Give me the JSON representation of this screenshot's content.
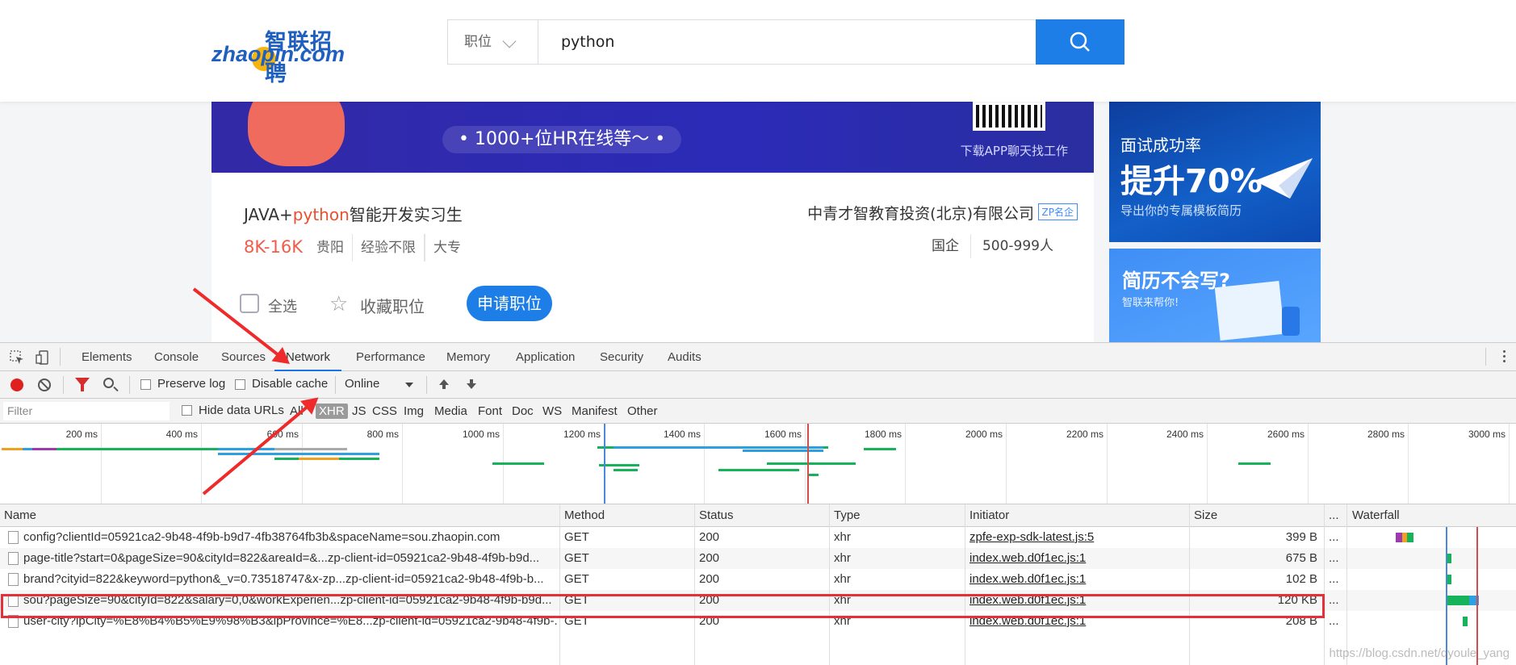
{
  "site": {
    "logo_cn": "智联招聘",
    "logo_en": "zhaopin.com",
    "search_category": "职位",
    "search_query": "python"
  },
  "banner": {
    "hr_text": "• 1000+位HR在线等～ •",
    "download_text": "下载APP聊天找工作"
  },
  "job": {
    "title_prefix": "JAVA+",
    "title_highlight": "python",
    "title_suffix": "智能开发实习生",
    "salary": "8K-16K",
    "tags": [
      "贵阳",
      "经验不限",
      "大专"
    ],
    "company": "中青才智教育投资(北京)有限公司",
    "company_badge": "ZP名企",
    "company_type": "国企",
    "company_size": "500-999人"
  },
  "actions": {
    "select_all": "全选",
    "favorite": "收藏职位",
    "apply": "申请职位"
  },
  "ads": {
    "ad1_line1": "面试成功率",
    "ad1_line2": "提升70%",
    "ad1_line3": "导出你的专属模板简历",
    "ad2_line1": "简历不会写?",
    "ad2_line2": "智联来帮你!"
  },
  "devtools": {
    "tabs": [
      "Elements",
      "Console",
      "Sources",
      "Network",
      "Performance",
      "Memory",
      "Application",
      "Security",
      "Audits"
    ],
    "active_tab": "Network",
    "preserve_log": "Preserve log",
    "disable_cache": "Disable cache",
    "throttle": "Online",
    "filter_placeholder": "Filter",
    "hide_data_urls": "Hide data URLs",
    "types": [
      "All",
      "XHR",
      "JS",
      "CSS",
      "Img",
      "Media",
      "Font",
      "Doc",
      "WS",
      "Manifest",
      "Other"
    ],
    "active_type": "XHR",
    "ticks": [
      "200 ms",
      "400 ms",
      "600 ms",
      "800 ms",
      "1000 ms",
      "1200 ms",
      "1400 ms",
      "1600 ms",
      "1800 ms",
      "2000 ms",
      "2200 ms",
      "2400 ms",
      "2600 ms",
      "2800 ms",
      "3000 ms"
    ],
    "columns": [
      "Name",
      "Method",
      "Status",
      "Type",
      "Initiator",
      "Size",
      "...",
      "Waterfall"
    ],
    "rows": [
      {
        "name": "config?clientId=05921ca2-9b48-4f9b-b9d7-4fb38764fb3b&spaceName=sou.zhaopin.com",
        "method": "GET",
        "status": "200",
        "type": "xhr",
        "initiator": "zpfe-exp-sdk-latest.js:5",
        "size": "399 B",
        "more": "..."
      },
      {
        "name": "page-title?start=0&pageSize=90&cityId=822&areaId=&...zp-client-id=05921ca2-9b48-4f9b-b9d...",
        "method": "GET",
        "status": "200",
        "type": "xhr",
        "initiator": "index.web.d0f1ec.js:1",
        "size": "675 B",
        "more": "..."
      },
      {
        "name": "brand?cityid=822&keyword=python&_v=0.73518747&x-zp...zp-client-id=05921ca2-9b48-4f9b-b...",
        "method": "GET",
        "status": "200",
        "type": "xhr",
        "initiator": "index.web.d0f1ec.js:1",
        "size": "102 B",
        "more": "..."
      },
      {
        "name": "sou?pageSize=90&cityId=822&salary=0,0&workExperien...zp-client-id=05921ca2-9b48-4f9b-b9d...",
        "method": "GET",
        "status": "200",
        "type": "xhr",
        "initiator": "index.web.d0f1ec.js:1",
        "size": "120 KB",
        "more": "..."
      },
      {
        "name": "user-city?ipCity=%E8%B4%B5%E9%98%B3&ipProvince=%E8...zp-client-id=05921ca2-9b48-4f9b-...",
        "method": "GET",
        "status": "200",
        "type": "xhr",
        "initiator": "index.web.d0f1ec.js:1",
        "size": "208 B",
        "more": "..."
      }
    ],
    "watermark": "https://blog.csdn.net/qyoule_yang"
  },
  "colors": {
    "brand_blue": "#1c7ee6",
    "salary_red": "#f25b4a",
    "annotation_red": "#e5303a",
    "devtools_active": "#1a73e8"
  }
}
